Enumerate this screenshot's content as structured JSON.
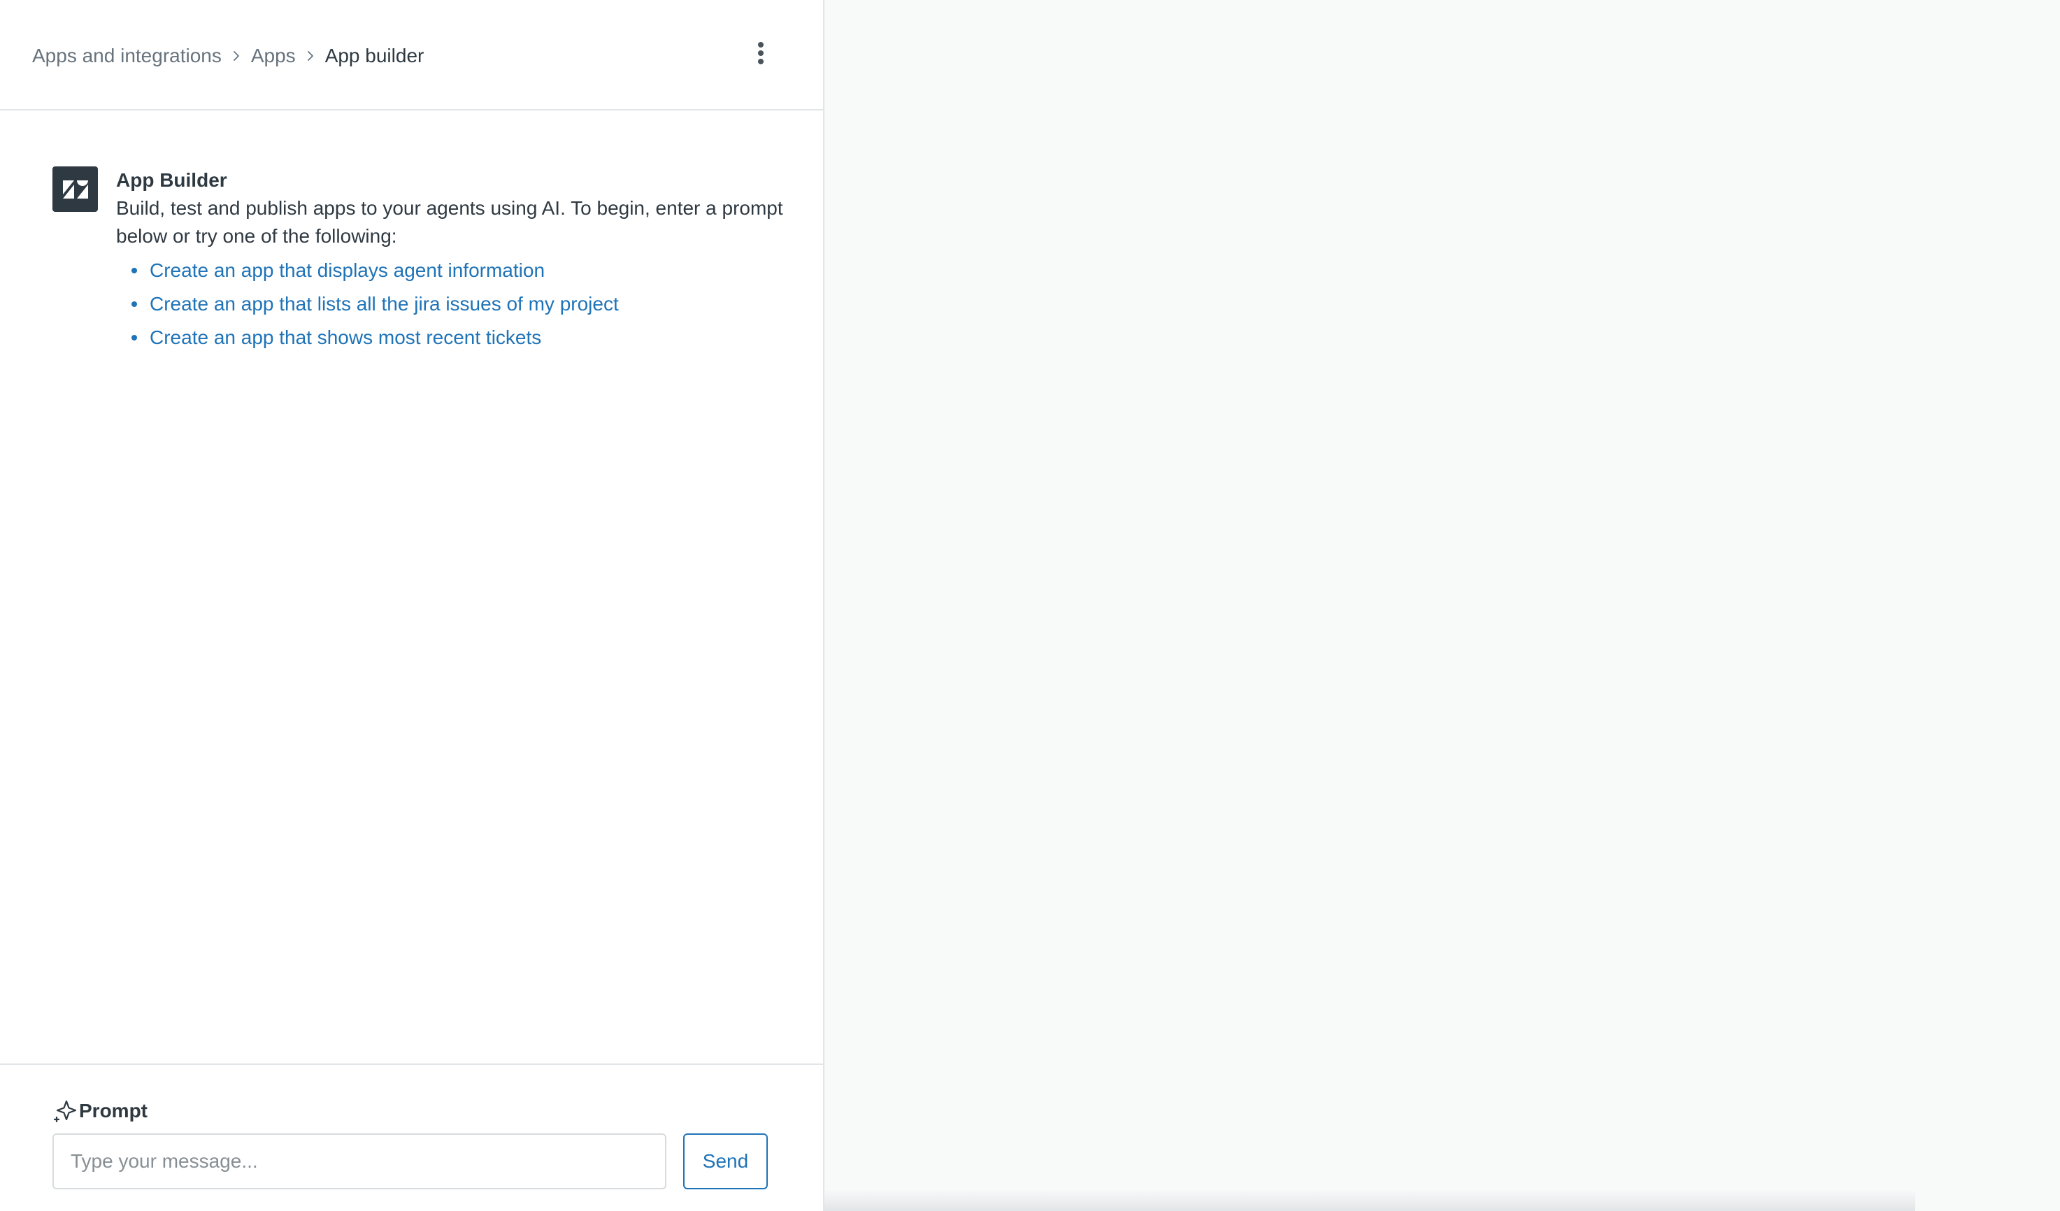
{
  "header": {
    "breadcrumb": [
      {
        "label": "Apps and integrations"
      },
      {
        "label": "Apps"
      },
      {
        "label": "App builder"
      }
    ],
    "more_icon": "kebab-vertical-icon"
  },
  "intro": {
    "logo_icon": "zendesk-logo-icon",
    "title": "App Builder",
    "text": "Build, test and publish apps to your agents using AI. To begin, enter a prompt below or try one of the following:",
    "suggestions": [
      {
        "label": "Create an app that displays agent information"
      },
      {
        "label": "Create an app that lists all the jira issues of my project"
      },
      {
        "label": "Create an app that shows most recent tickets"
      }
    ]
  },
  "prompt": {
    "label": "Prompt",
    "icon": "sparkle-icon",
    "placeholder": "Type your message...",
    "value": "",
    "send_label": "Send"
  },
  "colors": {
    "link": "#1f73b7",
    "text": "#2f3941",
    "muted": "#68737d",
    "border": "#e3e6e8",
    "preview_bg": "#f8f9f9"
  }
}
